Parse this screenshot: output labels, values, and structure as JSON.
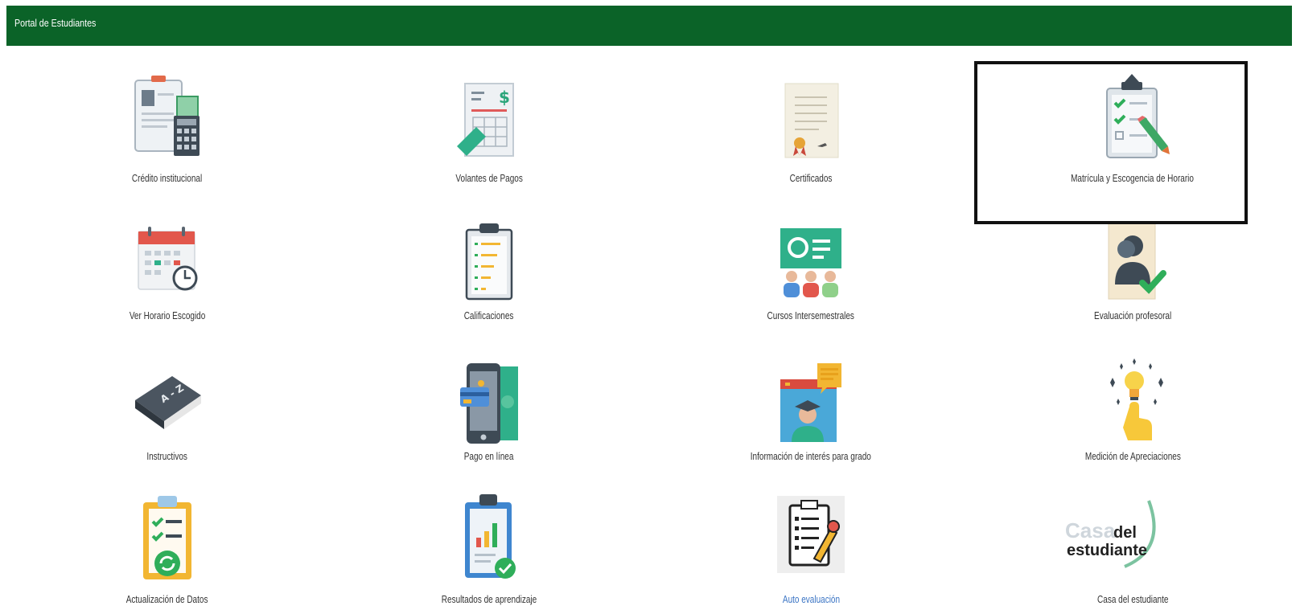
{
  "header": {
    "title": "Portal de Estudiantes",
    "color": "#0b6328"
  },
  "tiles": [
    {
      "label": "Crédito institucional",
      "icon": "institutional-credit-icon"
    },
    {
      "label": "Volantes de Pagos",
      "icon": "payment-voucher-icon"
    },
    {
      "label": "Certificados",
      "icon": "certificate-icon"
    },
    {
      "label": "Matrícula y Escogencia de Horario",
      "icon": "enrollment-checklist-icon",
      "highlighted": true
    },
    {
      "label": "Ver Horario Escogido",
      "icon": "calendar-clock-icon"
    },
    {
      "label": "Calificaciones",
      "icon": "grades-clipboard-icon"
    },
    {
      "label": "Cursos Intersemestrales",
      "icon": "classroom-icon"
    },
    {
      "label": "Evaluación profesoral",
      "icon": "teacher-evaluation-icon"
    },
    {
      "label": "Instructivos",
      "icon": "book-icon"
    },
    {
      "label": "Pago en línea",
      "icon": "online-payment-icon"
    },
    {
      "label": "Información de interés para grado",
      "icon": "graduation-info-icon"
    },
    {
      "label": "Medición de Apreciaciones",
      "icon": "lightbulb-hand-icon"
    },
    {
      "label": "Actualización de Datos",
      "icon": "data-update-icon"
    },
    {
      "label": "Resultados de aprendizaje",
      "icon": "learning-results-icon"
    },
    {
      "label": "Auto evaluación",
      "icon": "self-evaluation-icon",
      "link": true
    },
    {
      "label": "Casa del estudiante",
      "icon": "casa-del-estudiante-logo",
      "logo_text": [
        "Casa",
        "del",
        "estudiante"
      ]
    }
  ]
}
